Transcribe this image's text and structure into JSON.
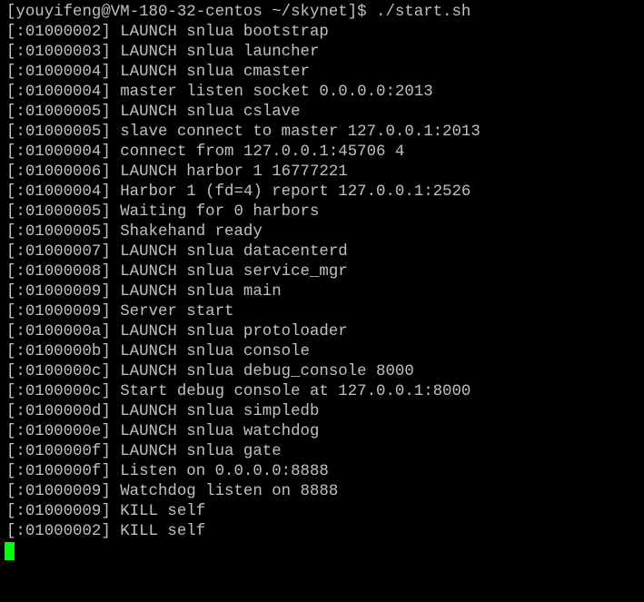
{
  "terminal": {
    "text_color": "#c0c0c0",
    "background_color": "#000000",
    "cursor_color": "#00ff00",
    "lines": [
      "[youyifeng@VM-180-32-centos ~/skynet]$ ./start.sh",
      "[:01000002] LAUNCH snlua bootstrap",
      "[:01000003] LAUNCH snlua launcher",
      "[:01000004] LAUNCH snlua cmaster",
      "[:01000004] master listen socket 0.0.0.0:2013",
      "[:01000005] LAUNCH snlua cslave",
      "[:01000005] slave connect to master 127.0.0.1:2013",
      "[:01000004] connect from 127.0.0.1:45706 4",
      "[:01000006] LAUNCH harbor 1 16777221",
      "[:01000004] Harbor 1 (fd=4) report 127.0.0.1:2526",
      "[:01000005] Waiting for 0 harbors",
      "[:01000005] Shakehand ready",
      "[:01000007] LAUNCH snlua datacenterd",
      "[:01000008] LAUNCH snlua service_mgr",
      "[:01000009] LAUNCH snlua main",
      "[:01000009] Server start",
      "[:0100000a] LAUNCH snlua protoloader",
      "[:0100000b] LAUNCH snlua console",
      "[:0100000c] LAUNCH snlua debug_console 8000",
      "[:0100000c] Start debug console at 127.0.0.1:8000",
      "[:0100000d] LAUNCH snlua simpledb",
      "[:0100000e] LAUNCH snlua watchdog",
      "[:0100000f] LAUNCH snlua gate",
      "[:0100000f] Listen on 0.0.0.0:8888",
      "[:01000009] Watchdog listen on 8888",
      "[:01000009] KILL self",
      "[:01000002] KILL self"
    ]
  }
}
